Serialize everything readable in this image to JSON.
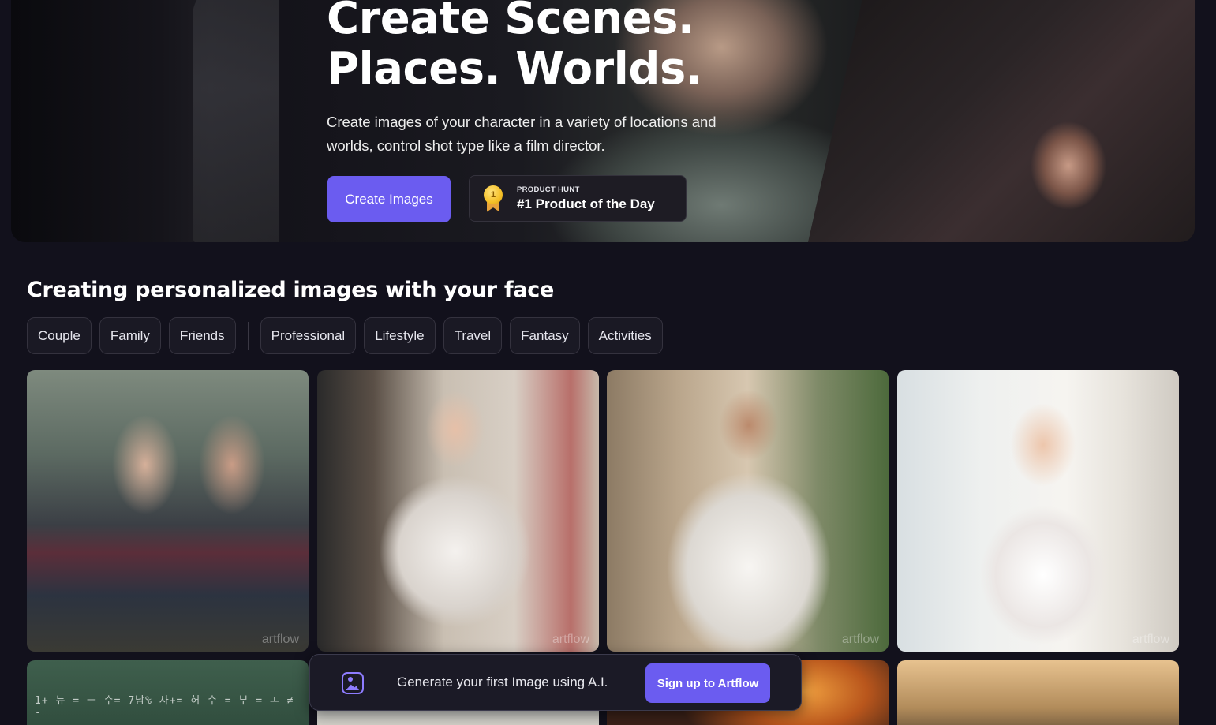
{
  "hero": {
    "title_line1": "Create Scenes.",
    "title_line2": "Places. Worlds.",
    "subtitle": "Create images of your character in a variety of locations and worlds, control shot type like a film director.",
    "cta_label": "Create Images",
    "badge": {
      "small": "PRODUCT HUNT",
      "big": "#1 Product of the Day",
      "medal_number": "1"
    }
  },
  "section": {
    "title": "Creating personalized images with your face",
    "chips_group1": [
      "Couple",
      "Family",
      "Friends"
    ],
    "chips_group2": [
      "Professional",
      "Lifestyle",
      "Travel",
      "Fantasy",
      "Activities"
    ]
  },
  "gallery": {
    "watermark": "artflow",
    "chalkboard_text": "1+ 뉴 = ㅡ 수= 7남% 사+= 허 수 = 부 = ㅗ ≠ -"
  },
  "signup_bar": {
    "icon": "image-icon",
    "text": "Generate your first Image using A.I.",
    "button_label": "Sign up to Artflow"
  },
  "colors": {
    "background": "#12111c",
    "accent": "#6b5cf0",
    "chip_border": "#34323e"
  }
}
